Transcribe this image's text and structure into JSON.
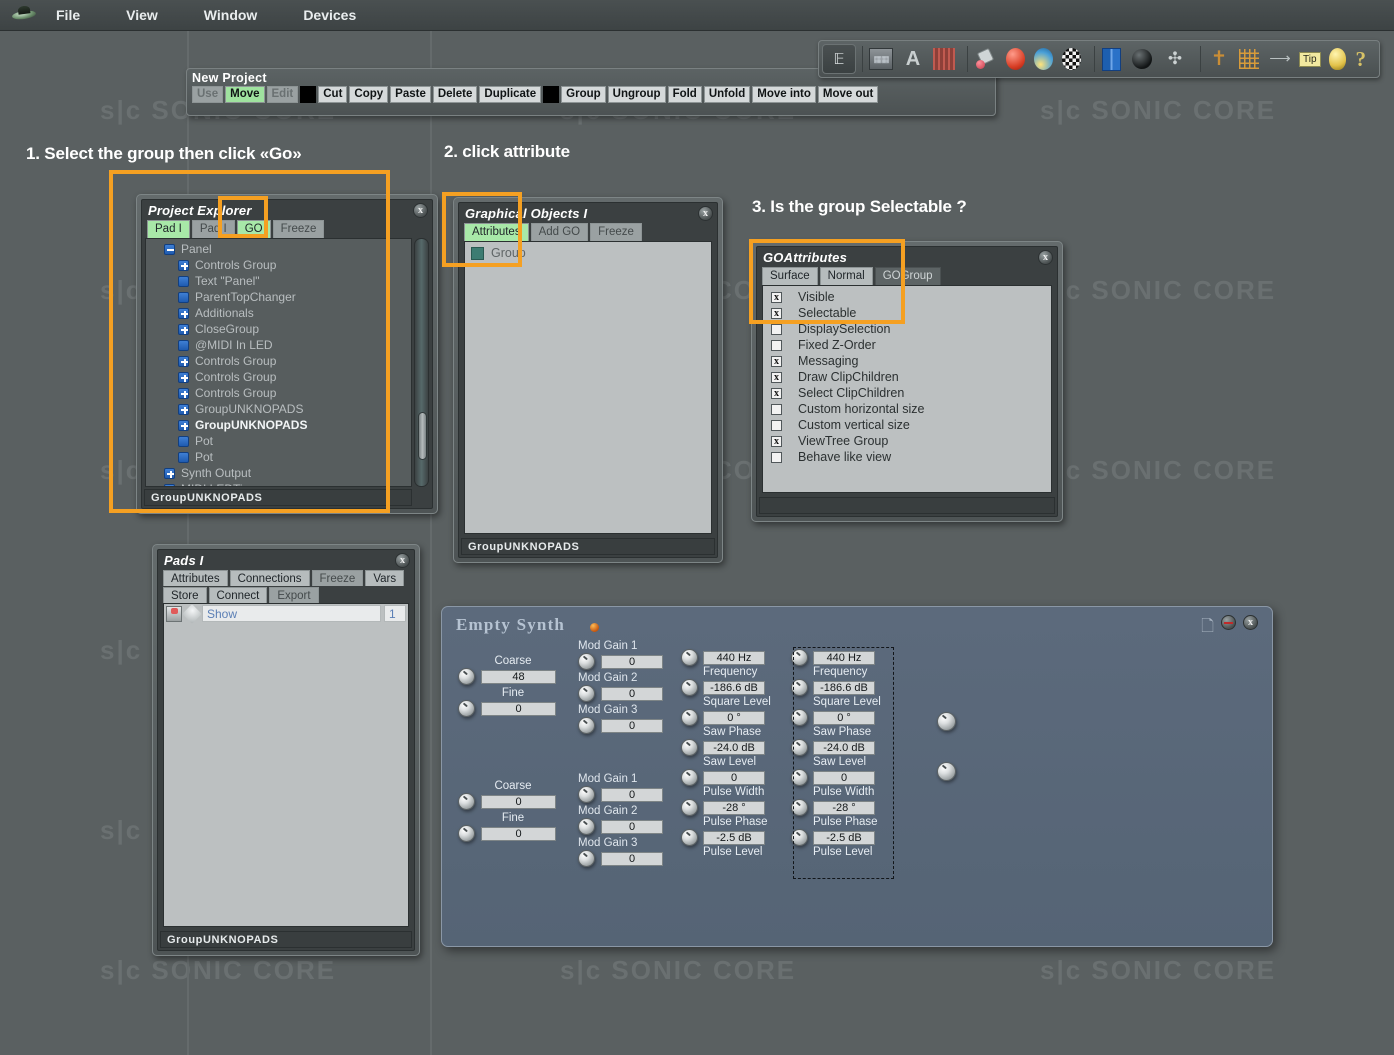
{
  "app": {
    "menu": [
      "File",
      "View",
      "Window",
      "Devices"
    ],
    "logo_icon": "ufo-logo-icon"
  },
  "toolbar_icons": [
    {
      "name": "tree-view-icon",
      "glyph": "ᴇ"
    },
    {
      "name": "film-strip-icon",
      "glyph": ""
    },
    {
      "name": "text-tool-icon",
      "glyph": "A"
    },
    {
      "name": "grid-red-icon",
      "glyph": ""
    },
    {
      "name": "paint-bucket-icon",
      "glyph": ""
    },
    {
      "name": "red-sphere-icon",
      "glyph": ""
    },
    {
      "name": "blue-sphere-icon",
      "glyph": ""
    },
    {
      "name": "checker-sphere-icon",
      "glyph": ""
    },
    {
      "name": "blue-book-icon",
      "glyph": ""
    },
    {
      "name": "black-sphere-icon",
      "glyph": ""
    },
    {
      "name": "move-arrows-icon",
      "glyph": ""
    },
    {
      "name": "tripod-icon",
      "glyph": ""
    },
    {
      "name": "yellow-grid-icon",
      "glyph": ""
    },
    {
      "name": "arrow-tool-icon",
      "glyph": ""
    },
    {
      "name": "tip-icon",
      "glyph": "Tip"
    },
    {
      "name": "lightbulb-icon",
      "glyph": ""
    },
    {
      "name": "help-icon",
      "glyph": "?"
    }
  ],
  "project_window": {
    "title": "New Project",
    "buttons": [
      {
        "label": "Use",
        "state": "dim"
      },
      {
        "label": "Move",
        "state": "green"
      },
      {
        "label": "Edit",
        "state": "dim"
      },
      {
        "label": "",
        "state": "black"
      },
      {
        "label": "Cut",
        "state": "normal"
      },
      {
        "label": "Copy",
        "state": "normal"
      },
      {
        "label": "Paste",
        "state": "normal"
      },
      {
        "label": "Delete",
        "state": "normal"
      },
      {
        "label": "Duplicate",
        "state": "normal"
      },
      {
        "label": "",
        "state": "black"
      },
      {
        "label": "Group",
        "state": "normal"
      },
      {
        "label": "Ungroup",
        "state": "normal"
      },
      {
        "label": "Fold",
        "state": "normal"
      },
      {
        "label": "Unfold",
        "state": "normal"
      },
      {
        "label": "Move into",
        "state": "normal"
      },
      {
        "label": "Move out",
        "state": "normal"
      }
    ]
  },
  "annotations": [
    {
      "id": "step1",
      "text": "1. Select the group then click «Go»"
    },
    {
      "id": "step2",
      "text": "2. click attribute"
    },
    {
      "id": "step3",
      "text": "3. Is the group Selectable ?"
    }
  ],
  "watermark": {
    "text": "s|c  SONIC CORE"
  },
  "project_explorer": {
    "title": "Project Explorer",
    "close_label": "x",
    "tabs": [
      {
        "label": "Pad I",
        "state": "green"
      },
      {
        "label": "Pad I",
        "state": "dim"
      },
      {
        "label": "GO",
        "state": "green"
      },
      {
        "label": "Freeze",
        "state": "dim"
      }
    ],
    "tree": [
      {
        "label": "Panel",
        "node": "minus",
        "indent": 1,
        "selected": false
      },
      {
        "label": "Controls Group",
        "node": "plus",
        "indent": 2,
        "selected": false
      },
      {
        "label": "Text \"Panel\"",
        "node": "leaf",
        "indent": 2,
        "selected": false
      },
      {
        "label": "ParentTopChanger",
        "node": "leaf",
        "indent": 2,
        "selected": false
      },
      {
        "label": "Additionals",
        "node": "plus",
        "indent": 2,
        "selected": false
      },
      {
        "label": "CloseGroup",
        "node": "plus",
        "indent": 2,
        "selected": false
      },
      {
        "label": "@MIDI In LED",
        "node": "leaf",
        "indent": 2,
        "selected": false
      },
      {
        "label": "Controls Group",
        "node": "plus",
        "indent": 2,
        "selected": false
      },
      {
        "label": "Controls Group",
        "node": "plus",
        "indent": 2,
        "selected": false
      },
      {
        "label": "Controls Group",
        "node": "plus",
        "indent": 2,
        "selected": false
      },
      {
        "label": "GroupUNKNOPADS",
        "node": "plus",
        "indent": 2,
        "selected": false
      },
      {
        "label": "GroupUNKNOPADS",
        "node": "plus",
        "indent": 2,
        "selected": true
      },
      {
        "label": "Pot",
        "node": "leaf",
        "indent": 2,
        "selected": false
      },
      {
        "label": "Pot",
        "node": "leaf",
        "indent": 2,
        "selected": false
      },
      {
        "label": "Synth Output",
        "node": "plus",
        "indent": 1,
        "selected": false
      },
      {
        "label": "MIDI LEDTimer",
        "node": "leaf",
        "indent": 1,
        "selected": false
      }
    ],
    "status": "GroupUNKNOPADS"
  },
  "graphical_objects": {
    "title": "Graphical Objects I",
    "close_label": "x",
    "tabs": [
      {
        "label": "Attributes",
        "state": "green"
      },
      {
        "label": "Add GO",
        "state": "dim"
      },
      {
        "label": "Freeze",
        "state": "dim"
      }
    ],
    "items": [
      {
        "label": "Group",
        "swatch": "#3d7c72"
      }
    ],
    "status": "GroupUNKNOPADS"
  },
  "go_attributes": {
    "title": "GOAttributes",
    "close_label": "x",
    "tabs": [
      {
        "label": "Surface",
        "state": "normal"
      },
      {
        "label": "Normal",
        "state": "normal"
      },
      {
        "label": "GOGroup",
        "state": "dark"
      }
    ],
    "checkboxes": [
      {
        "label": "Visible",
        "checked": true
      },
      {
        "label": "Selectable",
        "checked": true
      },
      {
        "label": "DisplaySelection",
        "checked": false
      },
      {
        "label": "Fixed Z-Order",
        "checked": false
      },
      {
        "label": "Messaging",
        "checked": true
      },
      {
        "label": "Draw ClipChildren",
        "checked": true
      },
      {
        "label": "Select ClipChildren",
        "checked": true
      },
      {
        "label": "Custom horizontal size",
        "checked": false
      },
      {
        "label": "Custom vertical size",
        "checked": false
      },
      {
        "label": "ViewTree Group",
        "checked": true
      },
      {
        "label": "Behave like view",
        "checked": false
      }
    ],
    "check_mark": "x"
  },
  "pads_window": {
    "title": "Pads I",
    "close_label": "x",
    "tabs_row1": [
      {
        "label": "Attributes",
        "state": "normal"
      },
      {
        "label": "Connections",
        "state": "normal"
      },
      {
        "label": "Freeze",
        "state": "dim"
      },
      {
        "label": "Vars",
        "state": "normal"
      }
    ],
    "tabs_row2": [
      {
        "label": "Store",
        "state": "normal"
      },
      {
        "label": "Connect",
        "state": "normal"
      },
      {
        "label": "Export",
        "state": "dim"
      }
    ],
    "entry": {
      "name": "Show",
      "value": "1",
      "note_icon": "note-icon",
      "diamond_icon": "diamond-icon"
    },
    "status": "GroupUNKNOPADS"
  },
  "empty_synth": {
    "title": "Empty Synth",
    "led_icon": "power-led-icon",
    "copy_icon": "copy-pages-icon",
    "minimize_label": "-",
    "close_label": "x",
    "osc_sections": [
      {
        "id": "osc1",
        "tune": {
          "coarse_label": "Coarse",
          "coarse_value": "48",
          "fine_label": "Fine",
          "fine_value": "0"
        },
        "mod": [
          {
            "label": "Mod Gain 1",
            "value": "0"
          },
          {
            "label": "Mod Gain 2",
            "value": "0"
          },
          {
            "label": "Mod Gain 3",
            "value": "0"
          }
        ]
      },
      {
        "id": "osc2",
        "tune": {
          "coarse_label": "Coarse",
          "coarse_value": "0",
          "fine_label": "Fine",
          "fine_value": "0"
        },
        "mod": [
          {
            "label": "Mod Gain 1",
            "value": "0"
          },
          {
            "label": "Mod Gain 2",
            "value": "0"
          },
          {
            "label": "Mod Gain 3",
            "value": "0"
          }
        ]
      }
    ],
    "param_columns": [
      {
        "id": "col-a",
        "selected": false,
        "params": [
          {
            "value": "440 Hz",
            "label": "Frequency"
          },
          {
            "value": "-186.6 dB",
            "label": "Square Level"
          },
          {
            "value": "0 °",
            "label": "Saw Phase"
          },
          {
            "value": "-24.0 dB",
            "label": "Saw Level"
          },
          {
            "value": "0",
            "label": "Pulse Width"
          },
          {
            "value": "-28 °",
            "label": "Pulse Phase"
          },
          {
            "value": "-2.5 dB",
            "label": "Pulse Level"
          }
        ]
      },
      {
        "id": "col-b",
        "selected": true,
        "params": [
          {
            "value": "440 Hz",
            "label": "Frequency"
          },
          {
            "value": "-186.6 dB",
            "label": "Square Level"
          },
          {
            "value": "0 °",
            "label": "Saw Phase"
          },
          {
            "value": "-24.0 dB",
            "label": "Saw Level"
          },
          {
            "value": "0",
            "label": "Pulse Width"
          },
          {
            "value": "-28 °",
            "label": "Pulse Phase"
          },
          {
            "value": "-2.5 dB",
            "label": "Pulse Level"
          }
        ]
      }
    ],
    "loose_knobs": [
      {
        "name": "loose-knob-1"
      },
      {
        "name": "loose-knob-2"
      }
    ]
  }
}
